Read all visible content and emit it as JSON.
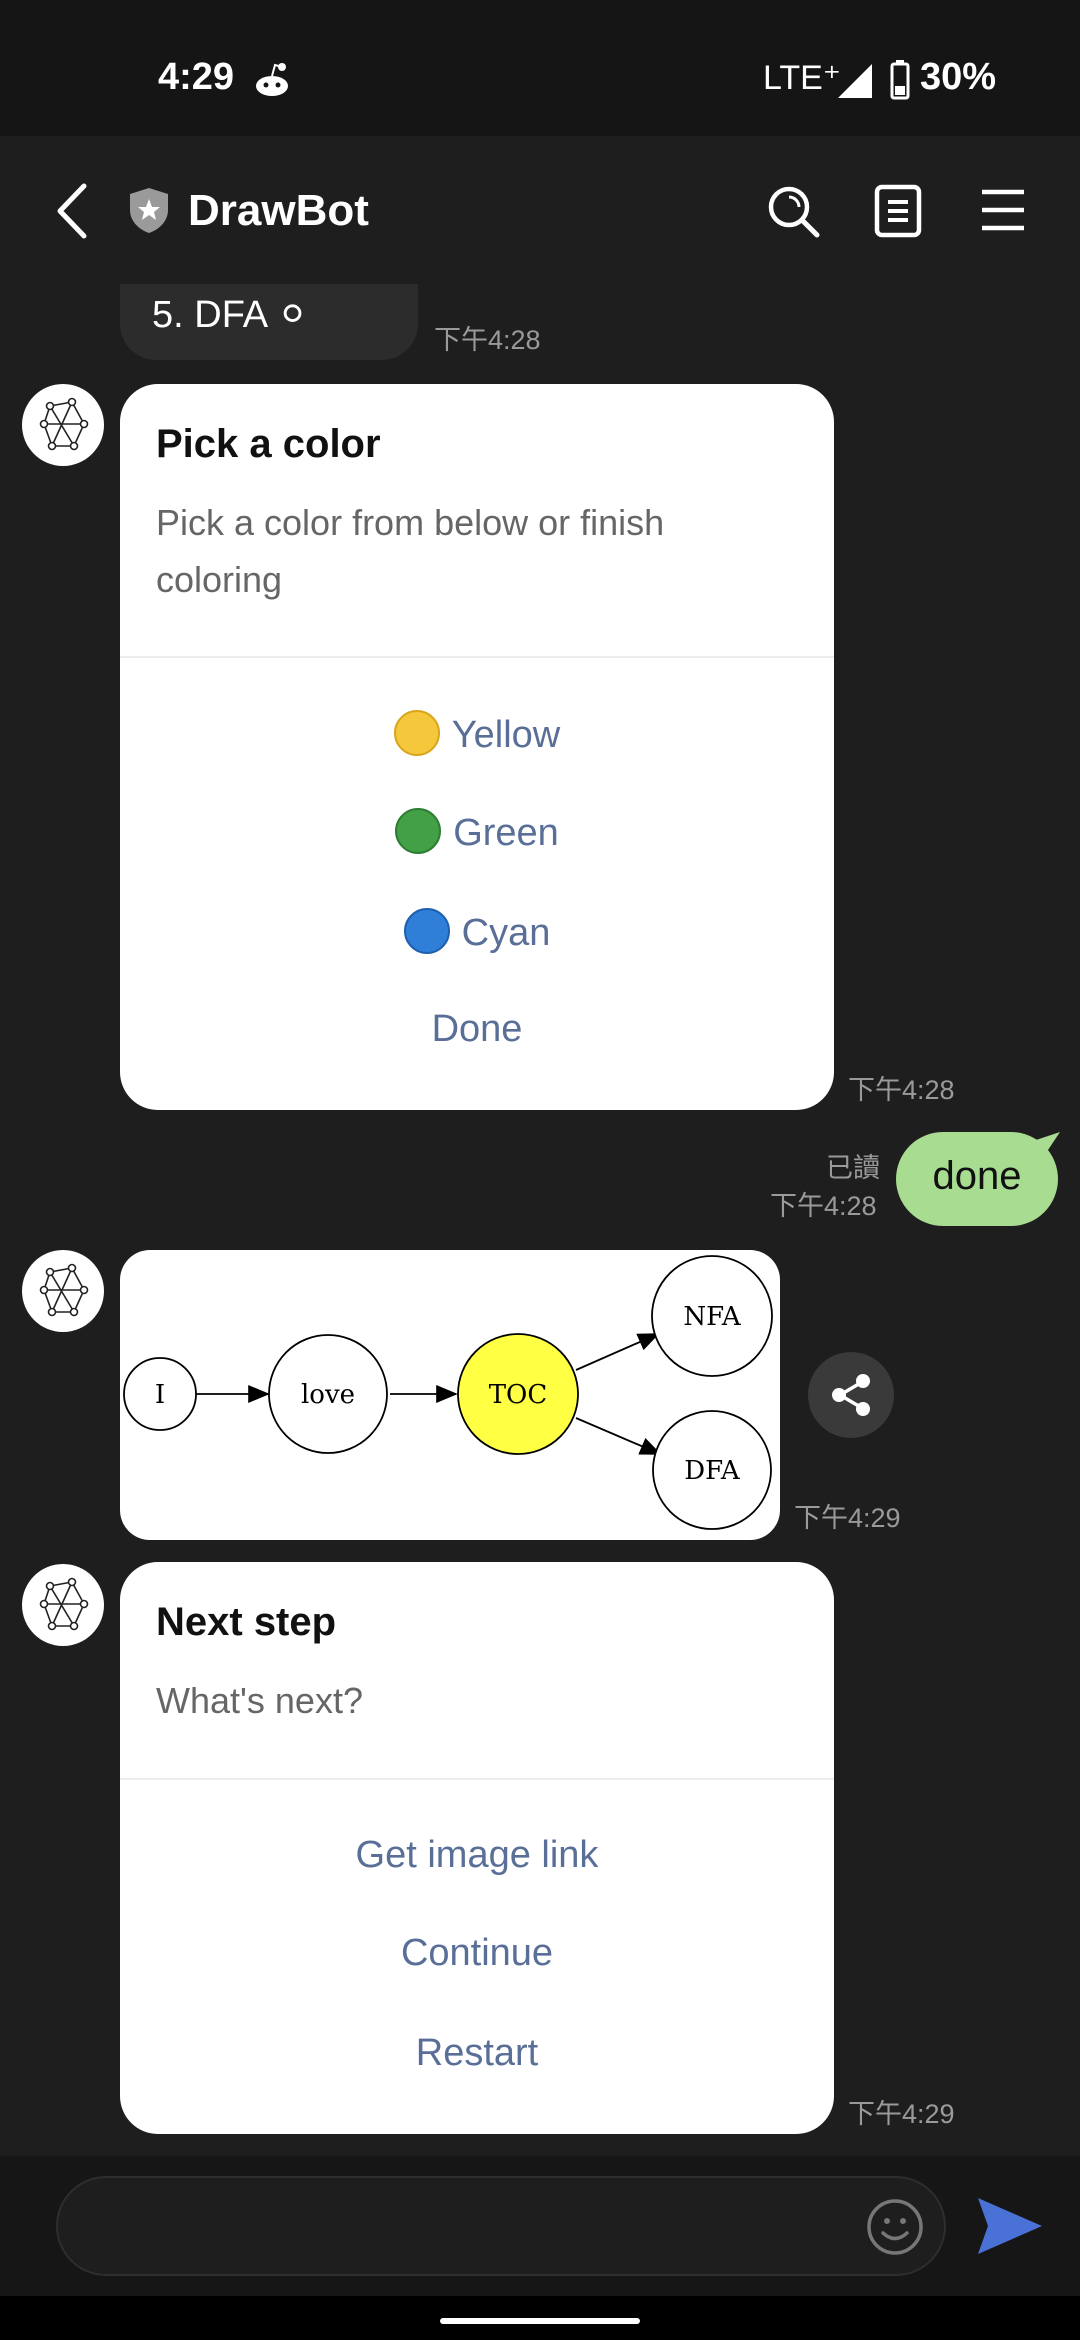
{
  "status_bar": {
    "time": "4:29",
    "network": "LTE⁺",
    "battery": "30%"
  },
  "header": {
    "title": "DrawBot",
    "icons": [
      "back-icon",
      "shield-icon",
      "search-icon",
      "notes-icon",
      "menu-icon"
    ]
  },
  "messages": {
    "prev_bubble": {
      "text": "5.  DFA ⚪",
      "time": "下午4:28"
    },
    "color_card": {
      "title": "Pick a color",
      "description": "Pick a color from below or finish coloring",
      "options": [
        {
          "label": "Yellow",
          "color": "#f5c83c"
        },
        {
          "label": "Green",
          "color": "#43a047"
        },
        {
          "label": "Cyan",
          "color": "#2f7fd8"
        }
      ],
      "done_label": "Done",
      "time": "下午4:28"
    },
    "user_message": {
      "text": "done",
      "read_label": "已讀",
      "time": "下午4:28"
    },
    "graph_image": {
      "nodes": [
        "I",
        "love",
        "TOC",
        "NFA",
        "DFA"
      ],
      "highlight_color": "#ffff44",
      "time": "下午4:29"
    },
    "next_card": {
      "title": "Next step",
      "description": "What's next?",
      "actions": [
        "Get image link",
        "Continue",
        "Restart"
      ],
      "time": "下午4:29"
    }
  },
  "input": {
    "placeholder": ""
  },
  "colors": {
    "background": "#1e1e1e",
    "user_bubble": "#a8dc91",
    "action_text": "#5a6f97",
    "send": "#4a72d6"
  }
}
